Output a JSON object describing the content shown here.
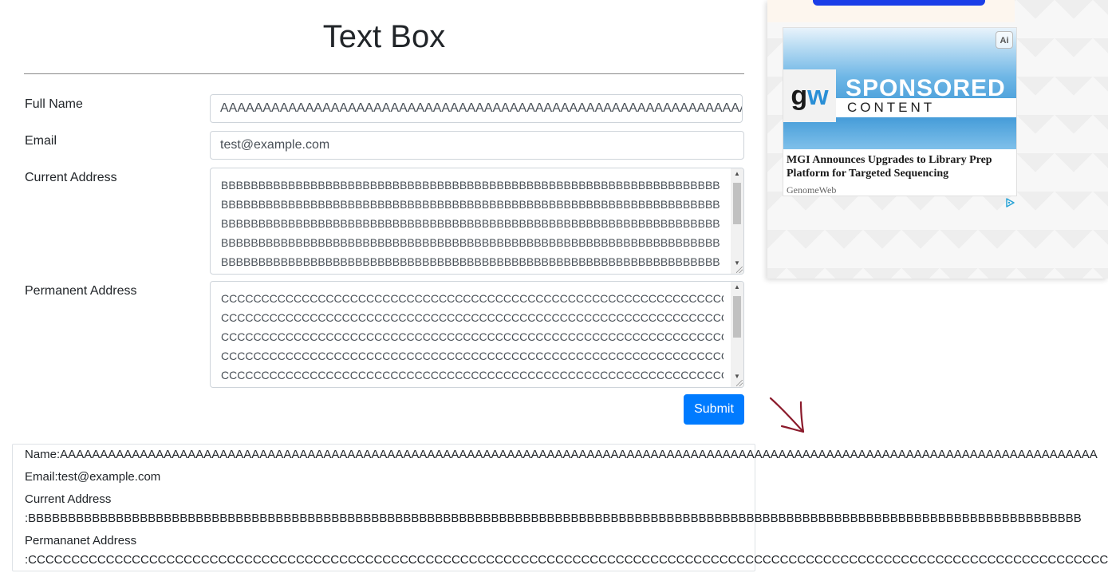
{
  "page": {
    "title": "Text Box"
  },
  "form": {
    "full_name_label": "Full Name",
    "full_name_value": "AAAAAAAAAAAAAAAAAAAAAAAAAAAAAAAAAAAAAAAAAAAAAAAAAAAAAAAAAAAAAAAAAAAAAAAAAAAAAAAAAAAAAAAAAAAAAAAAAAAA",
    "email_label": "Email",
    "email_value": "test@example.com",
    "current_address_label": "Current Address",
    "current_address_lines": [
      "BBBBBBBBBBBBBBBBBBBBBBBBBBBBBBBBBBBBBBBBBBBBBBBBBBBBBBBBBBBBBBBBBBB",
      "BBBBBBBBBBBBBBBBBBBBBBBBBBBBBBBBBBBBBBBBBBBBBBBBBBBBBBBBBBBBBBBBBBB",
      "BBBBBBBBBBBBBBBBBBBBBBBBBBBBBBBBBBBBBBBBBBBBBBBBBBBBBBBBBBBBBBBBBBB",
      "BBBBBBBBBBBBBBBBBBBBBBBBBBBBBBBBBBBBBBBBBBBBBBBBBBBBBBBBBBBBBBBBBBB",
      "BBBBBBBBBBBBBBBBBBBBBBBBBBBBBBBBBBBBBBBBBBBBBBBBBBBBBBBBBBBBBBBBBBB"
    ],
    "permanent_address_label": "Permanent Address",
    "permanent_address_lines": [
      "CCCCCCCCCCCCCCCCCCCCCCCCCCCCCCCCCCCCCCCCCCCCCCCCCCCCCCCCCCCCCCCCCCCC",
      "CCCCCCCCCCCCCCCCCCCCCCCCCCCCCCCCCCCCCCCCCCCCCCCCCCCCCCCCCCCCCCCCCCCC",
      "CCCCCCCCCCCCCCCCCCCCCCCCCCCCCCCCCCCCCCCCCCCCCCCCCCCCCCCCCCCCCCCCCCCC",
      "CCCCCCCCCCCCCCCCCCCCCCCCCCCCCCCCCCCCCCCCCCCCCCCCCCCCCCCCCCCCCCCCCCCC",
      "CCCCCCCCCCCCCCCCCCCCCCCCCCCCCCCCCCCCCCCCCCCCCCCCCCCCCCCCCCCCCCCCCCCC"
    ],
    "submit_label": "Submit"
  },
  "output": {
    "name": "Name:AAAAAAAAAAAAAAAAAAAAAAAAAAAAAAAAAAAAAAAAAAAAAAAAAAAAAAAAAAAAAAAAAAAAAAAAAAAAAAAAAAAAAAAAAAAAAAAAAAAAAAAAAAAAAAAAAAAAAAAAAAAAAAAAAA",
    "email": "Email:test@example.com",
    "current_address_label": "Current Address",
    "current_address_value": ":BBBBBBBBBBBBBBBBBBBBBBBBBBBBBBBBBBBBBBBBBBBBBBBBBBBBBBBBBBBBBBBBBBBBBBBBBBBBBBBBBBBBBBBBBBBBBBBBBBBBBBBBBBBBBBBBBBBBBBBBBBBBBBBBBBBB",
    "permanent_address_label": "Permananet Address",
    "permanent_address_value": ":CCCCCCCCCCCCCCCCCCCCCCCCCCCCCCCCCCCCCCCCCCCCCCCCCCCCCCCCCCCCCCCCCCCCCCCCCCCCCCCCCCCCCCCCCCCCCCCCCCCCCCCCCCCCCCCCCCCCCCCCCCCCCCCCCCCCC"
  },
  "ad": {
    "logo_g": "g",
    "logo_w": "w",
    "banner_title": "SPONSORED",
    "banner_subtitle": "CONTENT",
    "ai_badge": "Ai",
    "headline": "MGI Announces Upgrades to Library Prep Platform for Targeted Sequencing",
    "source": "GenomeWeb",
    "accent_color": "#1a3ee8"
  },
  "colors": {
    "primary": "#007bff",
    "text": "#212529",
    "border": "#ced4da",
    "annotation_arrow": "#8b1a2b"
  },
  "icons": {
    "scroll_up": "scroll-up-arrow-icon",
    "scroll_down": "scroll-down-arrow-icon",
    "resize": "resize-grip-icon",
    "ad_choices": "ad-choices-icon",
    "annotation": "hand-drawn-arrow-icon"
  }
}
